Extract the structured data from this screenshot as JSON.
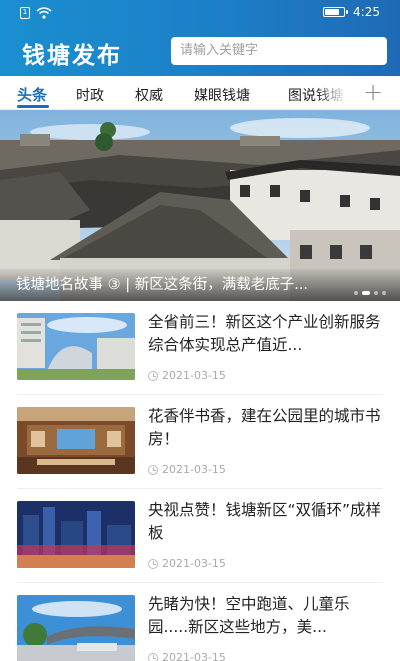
{
  "status_bar": {
    "time": "4:25"
  },
  "app": {
    "title": "钱塘发布"
  },
  "search": {
    "placeholder": "请输入关键字"
  },
  "tabs": [
    {
      "label": "头条",
      "active": true
    },
    {
      "label": "时政"
    },
    {
      "label": "权威"
    },
    {
      "label": "媒眼钱塘"
    },
    {
      "label": "图说钱塘"
    }
  ],
  "add_tab": {
    "label": "+"
  },
  "banner": {
    "caption": "钱塘地名故事 ③ | 新区这条街，满载老底子...",
    "slide_count": 4,
    "active_slide": 1
  },
  "news": [
    {
      "title": "全省前三！新区这个产业创新服务综合体实现总产值近...",
      "date": "2021-03-15"
    },
    {
      "title": "花香伴书香，建在公园里的城市书房！",
      "date": "2021-03-15"
    },
    {
      "title": "央视点赞！钱塘新区“双循环”成样板",
      "date": "2021-03-15"
    },
    {
      "title": "先睹为快！空中跑道、儿童乐园.....新区这些地方，美...",
      "date": "2021-03-15"
    }
  ]
}
